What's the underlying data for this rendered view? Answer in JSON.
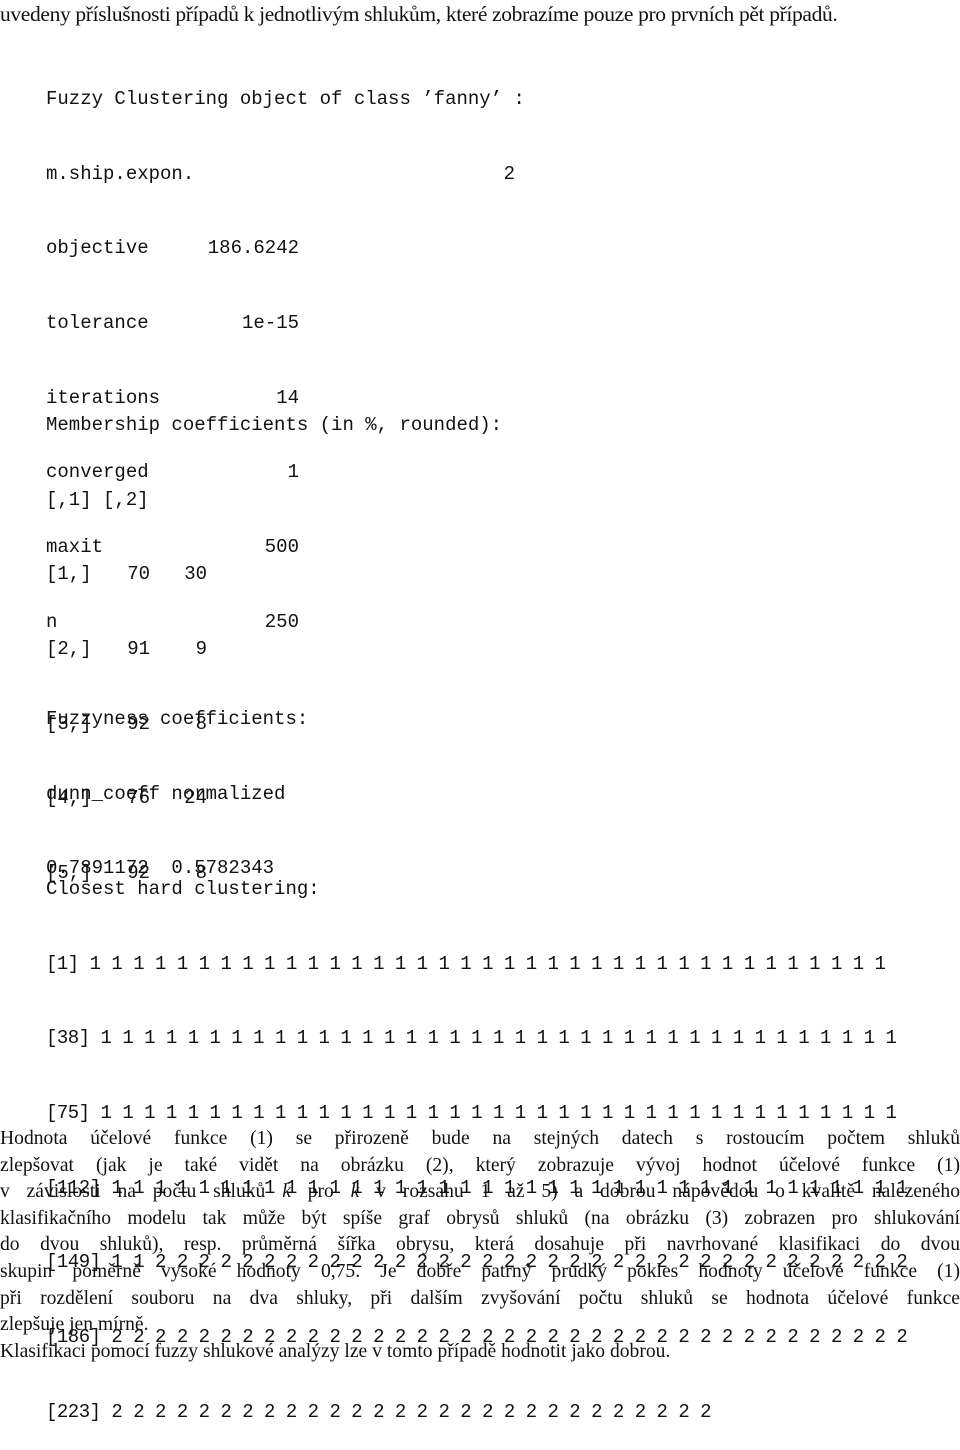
{
  "intro_line": "uvedeny příslušnosti případů k jednotlivým shlukům, které zobrazíme pouze pro prvních pět případů.",
  "fanny_summary": {
    "header": "Fuzzy Clustering object of class ’fanny’ :",
    "params": [
      {
        "key": "m.ship.expon.",
        "value": "2"
      },
      {
        "key": "objective",
        "value": "186.6242"
      },
      {
        "key": "tolerance",
        "value": "1e-15"
      },
      {
        "key": "iterations",
        "value": "14"
      },
      {
        "key": "converged",
        "value": "1"
      },
      {
        "key": "maxit",
        "value": "500"
      },
      {
        "key": "n",
        "value": "250"
      }
    ]
  },
  "membership": {
    "title": "Membership coefficients (in %, rounded):",
    "col_headers": [
      "[,1]",
      "[,2]"
    ],
    "rows": [
      {
        "label": "[1,]",
        "c1": "70",
        "c2": "30"
      },
      {
        "label": "[2,]",
        "c1": "91",
        "c2": "9"
      },
      {
        "label": "[3,]",
        "c1": "92",
        "c2": "8"
      },
      {
        "label": "[4,]",
        "c1": "76",
        "c2": "24"
      },
      {
        "label": "[5,]",
        "c1": "92",
        "c2": "8"
      }
    ]
  },
  "fuzzyness": {
    "title": "Fuzzyness coefficients:",
    "headers": "dunn_coeff normalized",
    "values": "0.7891172  0.5782343"
  },
  "clustering": {
    "title": "Closest hard clustering:",
    "rows": [
      {
        "index": "[1]",
        "values": "1 1 1 1 1 1 1 1 1 1 1 1 1 1 1 1 1 1 1 1 1 1 1 1 1 1 1 1 1 1 1 1 1 1 1 1 1"
      },
      {
        "index": "[38]",
        "values": "1 1 1 1 1 1 1 1 1 1 1 1 1 1 1 1 1 1 1 1 1 1 1 1 1 1 1 1 1 1 1 1 1 1 1 1 1"
      },
      {
        "index": "[75]",
        "values": "1 1 1 1 1 1 1 1 1 1 1 1 1 1 1 1 1 1 1 1 1 1 1 1 1 1 1 1 1 1 1 1 1 1 1 1 1"
      },
      {
        "index": "[112]",
        "values": "1 1 1 1 1 1 1 1 1 1 1 1 1 1 1 1 1 1 1 1 1 1 1 1 1 1 1 1 1 1 1 1 1 1 1 1 1"
      },
      {
        "index": "[149]",
        "values": "1 1 2 2 2 2 2 2 2 2 2 2 2 2 2 2 2 2 2 2 2 2 2 2 2 2 2 2 2 2 2 2 2 2 2 2 2"
      },
      {
        "index": "[186]",
        "values": "2 2 2 2 2 2 2 2 2 2 2 2 2 2 2 2 2 2 2 2 2 2 2 2 2 2 2 2 2 2 2 2 2 2 2 2 2"
      },
      {
        "index": "[223]",
        "values": "2 2 2 2 2 2 2 2 2 2 2 2 2 2 2 2 2 2 2 2 2 2 2 2 2 2 2 2"
      }
    ]
  },
  "paragraph": {
    "lines": [
      "Hodnota účelové funkce (1) se přirozeně bude na stejných datech s rostoucím počtem shluků",
      "zlepšovat (jak je také vidět na obrázku (2), který zobrazuje vývoj hodnot účelové funkce (1)",
      "v závislosti na počtu shluků k pro k v rozsahu 1 až 5) a dobrou nápovědou o kvalitě nalezeného",
      "klasifikačního modelu tak může být spíše graf obrysů shluků (na obrázku (3) zobrazen pro shlukování",
      "do dvou shluků), resp. průměrná šířka obrysu, která dosahuje při navrhované klasifikaci do dvou",
      "skupin poměrně vysoké hodnoty 0,75. Je dobře patrný prudký pokles hodnoty účelové funkce (1)",
      "při rozdělení souboru na dva shluky, při dalším zvyšování počtu shluků se hodnota účelové funkce",
      "zlepšuje jen mírně."
    ],
    "final_sentence": "Klasifikaci pomocí fuzzy shlukové analýzy lze v tomto případě hodnotit jako dobrou."
  }
}
